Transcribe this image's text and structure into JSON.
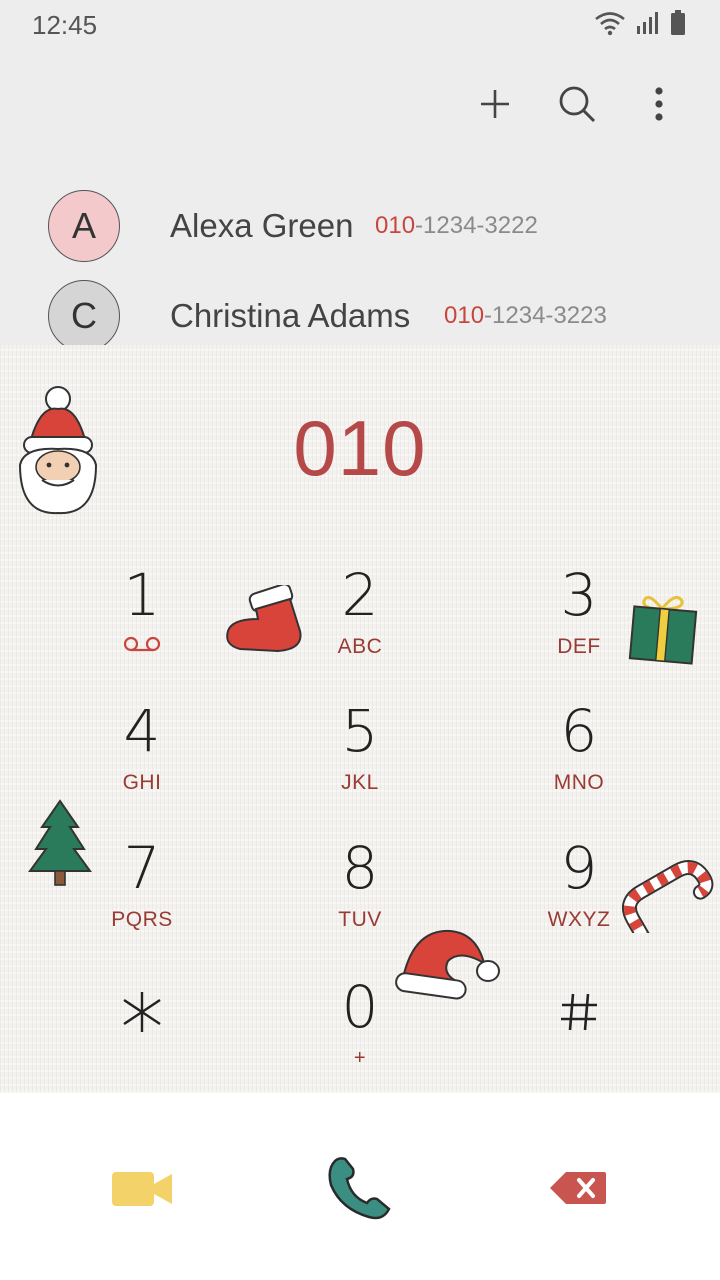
{
  "status": {
    "time": "12:45"
  },
  "actions": {
    "add": "add-icon",
    "search": "search-icon",
    "more": "more-vertical-icon"
  },
  "contacts": [
    {
      "initial": "A",
      "name": "Alexa Green",
      "number_prefix": "010",
      "number_rest": "-1234-3222",
      "avatar_color": "#f3c9cc"
    },
    {
      "initial": "C",
      "name": "Christina Adams",
      "number_prefix": "010",
      "number_rest": "-1234-3223",
      "avatar_color": "#d5d5d5"
    }
  ],
  "dialed_number": "010",
  "keys": [
    {
      "digit": "1",
      "letters": ""
    },
    {
      "digit": "2",
      "letters": "ABC"
    },
    {
      "digit": "3",
      "letters": "DEF"
    },
    {
      "digit": "4",
      "letters": "GHI"
    },
    {
      "digit": "5",
      "letters": "JKL"
    },
    {
      "digit": "6",
      "letters": "MNO"
    },
    {
      "digit": "7",
      "letters": "PQRS"
    },
    {
      "digit": "8",
      "letters": "TUV"
    },
    {
      "digit": "9",
      "letters": "WXYZ"
    },
    {
      "digit": "*",
      "letters": ""
    },
    {
      "digit": "0",
      "letters": "+"
    },
    {
      "digit": "#",
      "letters": ""
    }
  ],
  "bottom": {
    "video": "video-call-icon",
    "call": "phone-icon",
    "delete": "backspace-icon"
  },
  "colors": {
    "accent": "#c9463f",
    "digits": "#222222",
    "video": "#f3d26a",
    "call": "#3a8f82",
    "delete": "#c95550"
  }
}
